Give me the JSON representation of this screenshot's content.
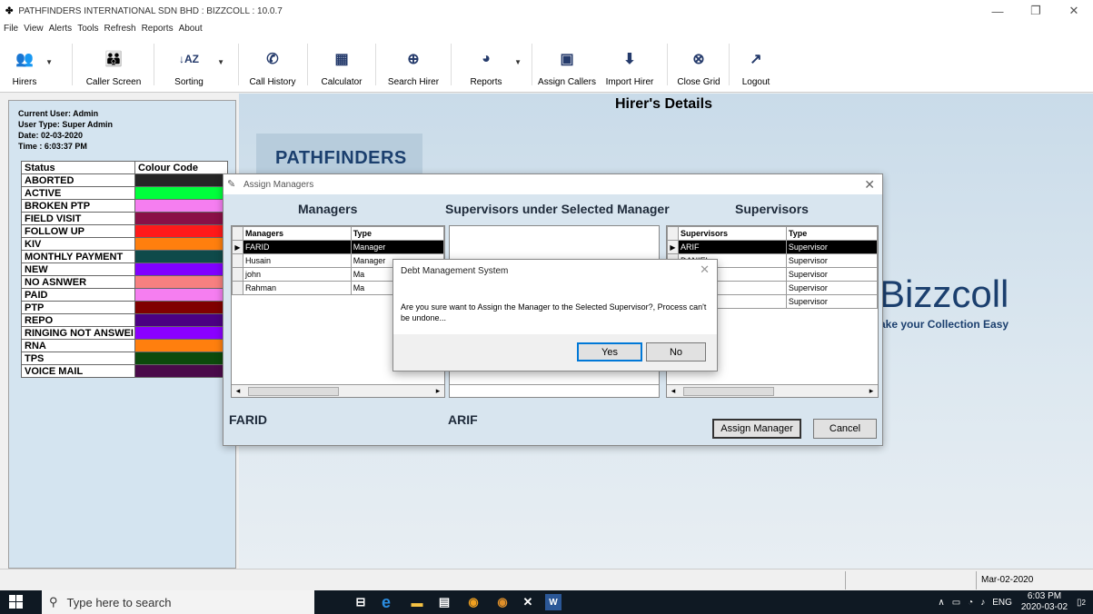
{
  "window": {
    "title": "PATHFINDERS INTERNATIONAL SDN BHD : BIZZCOLL : 10.0.7",
    "app_icon": "grid-icon",
    "controls": {
      "minimize": "—",
      "maximize": "❐",
      "close": "✕"
    }
  },
  "menu": [
    "File",
    "View",
    "Alerts",
    "Tools",
    "Refresh",
    "Reports",
    "About"
  ],
  "toolbar": [
    {
      "label": "Hirers",
      "icon": "users-icon",
      "glyph": "👥",
      "dropdown": true
    },
    {
      "label": "Caller Screen",
      "icon": "callers-icon",
      "glyph": "👪",
      "dropdown": false
    },
    {
      "label": "Sorting",
      "icon": "sort-az-icon",
      "glyph": "↓AZ",
      "dropdown": true
    },
    {
      "label": "Call History",
      "icon": "phone-icon",
      "glyph": "✆",
      "dropdown": false
    },
    {
      "label": "Calculator",
      "icon": "calculator-icon",
      "glyph": "▦",
      "dropdown": false
    },
    {
      "label": "Search Hirer",
      "icon": "search-icon",
      "glyph": "⊕",
      "dropdown": false
    },
    {
      "label": "Reports",
      "icon": "pie-chart-icon",
      "glyph": "◕",
      "dropdown": true
    },
    {
      "label": "Assign Callers",
      "icon": "id-card-icon",
      "glyph": "▣",
      "dropdown": false
    },
    {
      "label": "Import Hirer",
      "icon": "download-icon",
      "glyph": "⬇",
      "dropdown": false
    },
    {
      "label": "Close Grid",
      "icon": "close-circle-icon",
      "glyph": "⊗",
      "dropdown": false
    },
    {
      "label": "Logout",
      "icon": "logout-icon",
      "glyph": "↗",
      "dropdown": false
    }
  ],
  "user_info": {
    "current_user": "Current User: Admin",
    "user_type": "User Type: Super Admin",
    "date": "Date: 02-03-2020",
    "time": "Time : 6:03:37 PM"
  },
  "status_table": {
    "headers": [
      "Status",
      "Colour Code"
    ],
    "rows": [
      {
        "status": "ABORTED",
        "color": "#262626"
      },
      {
        "status": "ACTIVE",
        "color": "#00ff3c"
      },
      {
        "status": "BROKEN PTP",
        "color": "#f57ef0"
      },
      {
        "status": "FIELD VISIT",
        "color": "#8a1047"
      },
      {
        "status": "FOLLOW UP",
        "color": "#ff1a1a"
      },
      {
        "status": "KIV",
        "color": "#ff7f0e"
      },
      {
        "status": "MONTHLY PAYMENT",
        "color": "#0f4a4a"
      },
      {
        "status": "NEW",
        "color": "#8000ff"
      },
      {
        "status": "NO ASNWER",
        "color": "#f78080"
      },
      {
        "status": "PAID",
        "color": "#f57ef0"
      },
      {
        "status": "PTP",
        "color": "#800000"
      },
      {
        "status": "REPO",
        "color": "#4b0082"
      },
      {
        "status": "RINGING NOT ANSWEI",
        "color": "#8a00ff"
      },
      {
        "status": "RNA",
        "color": "#ff7f0e"
      },
      {
        "status": "TPS",
        "color": "#0c4a0c"
      },
      {
        "status": "VOICE MAIL",
        "color": "#4a0a4a"
      }
    ]
  },
  "main": {
    "title": "Hirer's Details",
    "logo_text": "PATHFINDERS",
    "bizz_text": "Bizzcoll",
    "bizz_sub": "ake your Collection Easy"
  },
  "assign_dialog": {
    "title": "Assign Managers",
    "managers_head": "Managers",
    "supervisors_under_head": "Supervisors under Selected Manager",
    "supervisors_head": "Supervisors",
    "managers_grid": {
      "headers": [
        "Managers",
        "Type"
      ],
      "rows": [
        {
          "name": "FARID",
          "type": "Manager",
          "selected": true
        },
        {
          "name": "Husain",
          "type": "Manager",
          "selected": false
        },
        {
          "name": "john",
          "type": "Ma",
          "selected": false
        },
        {
          "name": "Rahman",
          "type": "Ma",
          "selected": false
        }
      ]
    },
    "supervisors_grid": {
      "headers": [
        "Supervisors",
        "Type"
      ],
      "rows": [
        {
          "name": "ARIF",
          "type": "Supervisor",
          "selected": true
        },
        {
          "name": "DANIEL",
          "type": "Supervisor",
          "selected": false
        },
        {
          "name": "",
          "type": "Supervisor",
          "selected": false
        },
        {
          "name": "",
          "type": "Supervisor",
          "selected": false
        },
        {
          "name": "",
          "type": "Supervisor",
          "selected": false
        }
      ]
    },
    "selected_manager": "FARID",
    "selected_supervisor": "ARIF",
    "assign_button": "Assign Manager",
    "cancel_button": "Cancel"
  },
  "message_box": {
    "title": "Debt Management System",
    "text": "Are you sure want to Assign the Manager to the Selected Supervisor?, Process can't be undone...",
    "yes": "Yes",
    "no": "No"
  },
  "statusbar": {
    "date": "Mar-02-2020"
  },
  "taskbar": {
    "search_placeholder": "Type here to search",
    "time": "6:03 PM",
    "date": "2020-03-02",
    "lang": "ENG",
    "notification_count": "2"
  }
}
